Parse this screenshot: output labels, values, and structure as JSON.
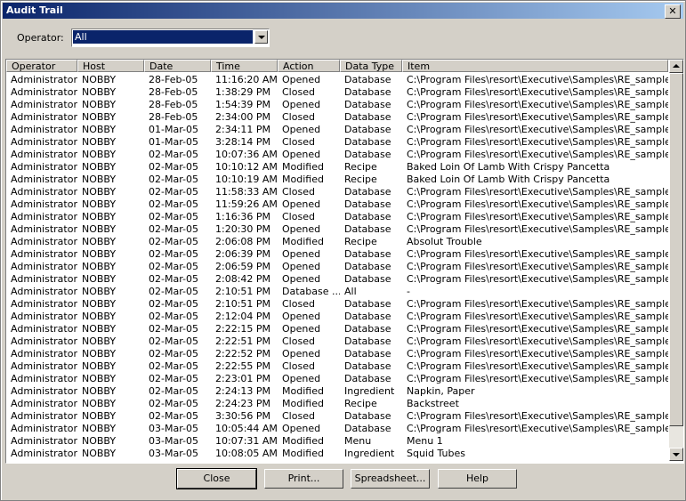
{
  "window": {
    "title": "Audit Trail",
    "close_glyph": "✕"
  },
  "operator": {
    "label": "Operator:",
    "value": "All"
  },
  "columns": [
    "Operator",
    "Host",
    "Date",
    "Time",
    "Action",
    "Data Type",
    "Item"
  ],
  "rows": [
    [
      "Administrator",
      "NOBBY",
      "28-Feb-05",
      "11:16:20 AM",
      "Opened",
      "Database",
      "C:\\Program Files\\resort\\Executive\\Samples\\RE_samples_..."
    ],
    [
      "Administrator",
      "NOBBY",
      "28-Feb-05",
      "1:38:29 PM",
      "Closed",
      "Database",
      "C:\\Program Files\\resort\\Executive\\Samples\\RE_samples_..."
    ],
    [
      "Administrator",
      "NOBBY",
      "28-Feb-05",
      "1:54:39 PM",
      "Opened",
      "Database",
      "C:\\Program Files\\resort\\Executive\\Samples\\RE_samples_..."
    ],
    [
      "Administrator",
      "NOBBY",
      "28-Feb-05",
      "2:34:00 PM",
      "Closed",
      "Database",
      "C:\\Program Files\\resort\\Executive\\Samples\\RE_samples_..."
    ],
    [
      "Administrator",
      "NOBBY",
      "01-Mar-05",
      "2:34:11 PM",
      "Opened",
      "Database",
      "C:\\Program Files\\resort\\Executive\\Samples\\RE_samples_..."
    ],
    [
      "Administrator",
      "NOBBY",
      "01-Mar-05",
      "3:28:14 PM",
      "Closed",
      "Database",
      "C:\\Program Files\\resort\\Executive\\Samples\\RE_samples_..."
    ],
    [
      "Administrator",
      "NOBBY",
      "02-Mar-05",
      "10:07:36 AM",
      "Opened",
      "Database",
      "C:\\Program Files\\resort\\Executive\\Samples\\RE_samples_..."
    ],
    [
      "Administrator",
      "NOBBY",
      "02-Mar-05",
      "10:10:12 AM",
      "Modified",
      "Recipe",
      "Baked Loin Of Lamb With Crispy Pancetta"
    ],
    [
      "Administrator",
      "NOBBY",
      "02-Mar-05",
      "10:10:19 AM",
      "Modified",
      "Recipe",
      "Baked Loin Of Lamb With Crispy Pancetta"
    ],
    [
      "Administrator",
      "NOBBY",
      "02-Mar-05",
      "11:58:33 AM",
      "Closed",
      "Database",
      "C:\\Program Files\\resort\\Executive\\Samples\\RE_samples_..."
    ],
    [
      "Administrator",
      "NOBBY",
      "02-Mar-05",
      "11:59:26 AM",
      "Opened",
      "Database",
      "C:\\Program Files\\resort\\Executive\\Samples\\RE_samples_..."
    ],
    [
      "Administrator",
      "NOBBY",
      "02-Mar-05",
      "1:16:36 PM",
      "Closed",
      "Database",
      "C:\\Program Files\\resort\\Executive\\Samples\\RE_samples_..."
    ],
    [
      "Administrator",
      "NOBBY",
      "02-Mar-05",
      "1:20:30 PM",
      "Opened",
      "Database",
      "C:\\Program Files\\resort\\Executive\\Samples\\RE_samples_..."
    ],
    [
      "Administrator",
      "NOBBY",
      "02-Mar-05",
      "2:06:08 PM",
      "Modified",
      "Recipe",
      "Absolut Trouble"
    ],
    [
      "Administrator",
      "NOBBY",
      "02-Mar-05",
      "2:06:39 PM",
      "Opened",
      "Database",
      "C:\\Program Files\\resort\\Executive\\Samples\\RE_samples_..."
    ],
    [
      "Administrator",
      "NOBBY",
      "02-Mar-05",
      "2:06:59 PM",
      "Opened",
      "Database",
      "C:\\Program Files\\resort\\Executive\\Samples\\RE_samples_..."
    ],
    [
      "Administrator",
      "NOBBY",
      "02-Mar-05",
      "2:08:42 PM",
      "Opened",
      "Database",
      "C:\\Program Files\\resort\\Executive\\Samples\\RE_samples_..."
    ],
    [
      "Administrator",
      "NOBBY",
      "02-Mar-05",
      "2:10:51 PM",
      "Database ...",
      "All",
      "-"
    ],
    [
      "Administrator",
      "NOBBY",
      "02-Mar-05",
      "2:10:51 PM",
      "Closed",
      "Database",
      "C:\\Program Files\\resort\\Executive\\Samples\\RE_samples_..."
    ],
    [
      "Administrator",
      "NOBBY",
      "02-Mar-05",
      "2:12:04 PM",
      "Opened",
      "Database",
      "C:\\Program Files\\resort\\Executive\\Samples\\RE_samples_..."
    ],
    [
      "Administrator",
      "NOBBY",
      "02-Mar-05",
      "2:22:15 PM",
      "Opened",
      "Database",
      "C:\\Program Files\\resort\\Executive\\Samples\\RE_samples_..."
    ],
    [
      "Administrator",
      "NOBBY",
      "02-Mar-05",
      "2:22:51 PM",
      "Closed",
      "Database",
      "C:\\Program Files\\resort\\Executive\\Samples\\RE_samples_..."
    ],
    [
      "Administrator",
      "NOBBY",
      "02-Mar-05",
      "2:22:52 PM",
      "Opened",
      "Database",
      "C:\\Program Files\\resort\\Executive\\Samples\\RE_samples_..."
    ],
    [
      "Administrator",
      "NOBBY",
      "02-Mar-05",
      "2:22:55 PM",
      "Closed",
      "Database",
      "C:\\Program Files\\resort\\Executive\\Samples\\RE_samples_..."
    ],
    [
      "Administrator",
      "NOBBY",
      "02-Mar-05",
      "2:23:01 PM",
      "Opened",
      "Database",
      "C:\\Program Files\\resort\\Executive\\Samples\\RE_samples_..."
    ],
    [
      "Administrator",
      "NOBBY",
      "02-Mar-05",
      "2:24:13 PM",
      "Modified",
      "Ingredient",
      "Napkin, Paper"
    ],
    [
      "Administrator",
      "NOBBY",
      "02-Mar-05",
      "2:24:23 PM",
      "Modified",
      "Recipe",
      "Backstreet"
    ],
    [
      "Administrator",
      "NOBBY",
      "02-Mar-05",
      "3:30:56 PM",
      "Closed",
      "Database",
      "C:\\Program Files\\resort\\Executive\\Samples\\RE_samples_..."
    ],
    [
      "Administrator",
      "NOBBY",
      "03-Mar-05",
      "10:05:44 AM",
      "Opened",
      "Database",
      "C:\\Program Files\\resort\\Executive\\Samples\\RE_samples_..."
    ],
    [
      "Administrator",
      "NOBBY",
      "03-Mar-05",
      "10:07:31 AM",
      "Modified",
      "Menu",
      "Menu 1"
    ],
    [
      "Administrator",
      "NOBBY",
      "03-Mar-05",
      "10:08:05 AM",
      "Modified",
      "Ingredient",
      "Squid Tubes"
    ]
  ],
  "buttons": {
    "close": "Close",
    "print": "Print...",
    "spreadsheet": "Spreadsheet...",
    "help": "Help"
  }
}
